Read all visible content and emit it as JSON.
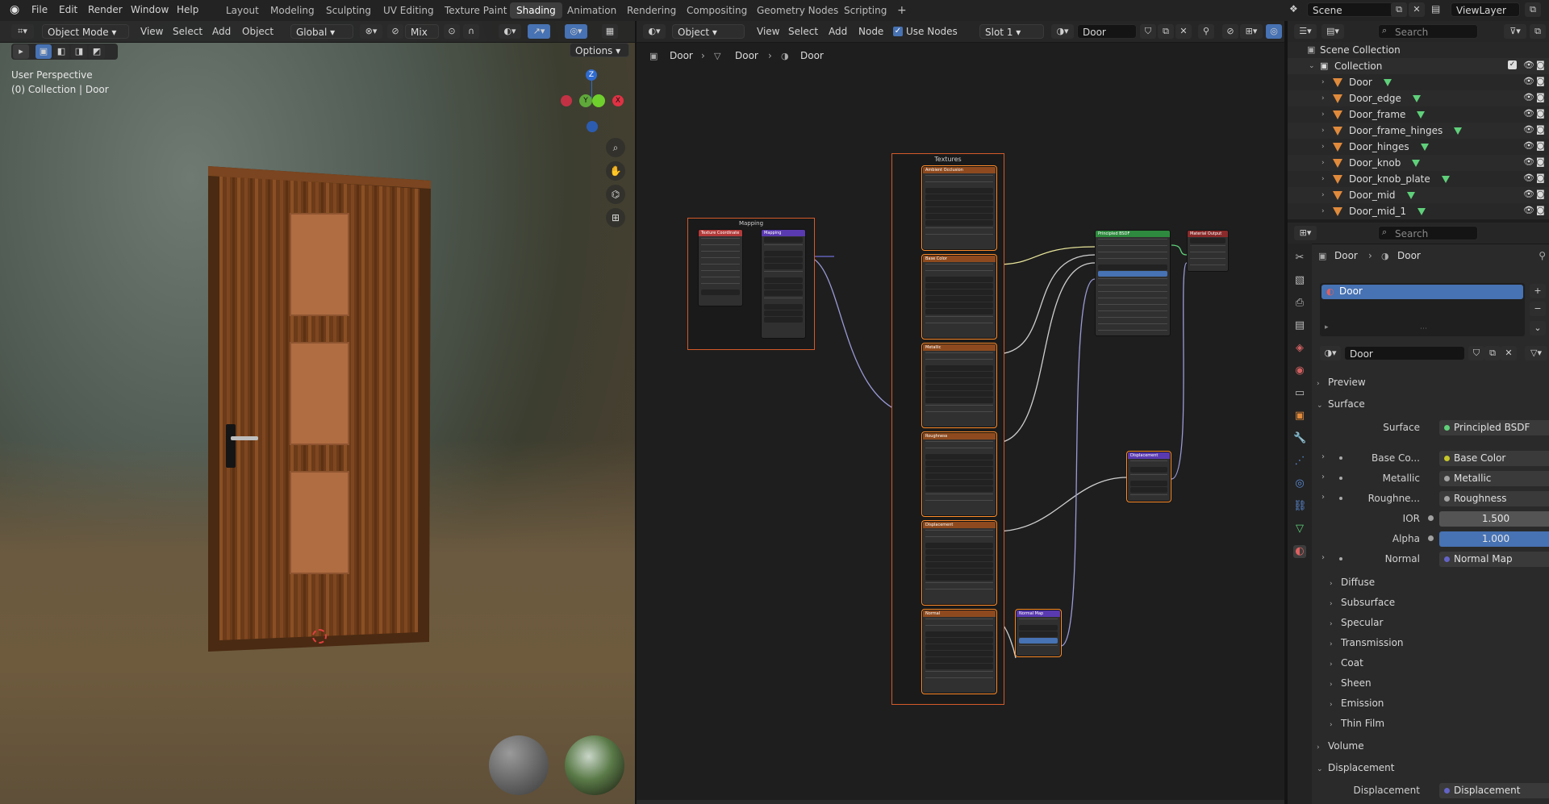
{
  "topbar": {
    "menus": [
      "File",
      "Edit",
      "Render",
      "Window",
      "Help"
    ],
    "workspaces": [
      "Layout",
      "Modeling",
      "Sculpting",
      "UV Editing",
      "Texture Paint",
      "Shading",
      "Animation",
      "Rendering",
      "Compositing",
      "Geometry Nodes",
      "Scripting"
    ],
    "active_workspace": "Shading",
    "add_tab": "+",
    "scene_label": "Scene",
    "viewlayer_label": "ViewLayer"
  },
  "viewport": {
    "mode": "Object Mode",
    "menus": [
      "View",
      "Select",
      "Add",
      "Object"
    ],
    "transform": "Global",
    "pivot": "Mix",
    "options": "Options",
    "perspective": "User Perspective",
    "collection_info": "(0) Collection | Door",
    "gizmo": {
      "z": "Z",
      "y": "Y",
      "x": "X"
    }
  },
  "node_editor": {
    "type": "Object",
    "menus": [
      "View",
      "Select",
      "Add",
      "Node"
    ],
    "use_nodes_label": "Use Nodes",
    "slot": "Slot 1",
    "material": "Door",
    "breadcrumb": [
      "Door",
      "Door",
      "Door"
    ],
    "frames": {
      "mapping": "Mapping",
      "textures": "Textures"
    },
    "nodes": {
      "tex_coord": "Texture Coordinate",
      "mapping": "Mapping",
      "ao": "Ambient Occlusion",
      "base_color": "Base Color",
      "metallic": "Metallic",
      "roughness": "Roughness",
      "displacement": "Displacement",
      "normal": "Normal",
      "bsdf": "Principled BSDF",
      "output": "Material Output",
      "disp_node": "Displacement",
      "normal_map": "Normal Map"
    }
  },
  "outliner": {
    "search_placeholder": "Search",
    "root": "Scene Collection",
    "collection": "Collection",
    "items": [
      "Door",
      "Door_edge",
      "Door_frame",
      "Door_frame_hinges",
      "Door_hinges",
      "Door_knob",
      "Door_knob_plate",
      "Door_mid",
      "Door_mid_1"
    ]
  },
  "properties": {
    "search_placeholder": "Search",
    "breadcrumb": [
      "Door",
      "Door"
    ],
    "slot_item": "Door",
    "material_name": "Door",
    "sections": {
      "preview": "Preview",
      "surface": "Surface",
      "volume": "Volume",
      "displacement": "Displacement"
    },
    "surface_row": {
      "label": "Surface",
      "value": "Principled BSDF"
    },
    "inputs": [
      {
        "label": "Base Co...",
        "value": "Base Color",
        "type": "link",
        "color": "#c7c729"
      },
      {
        "label": "Metallic",
        "value": "Metallic",
        "type": "link",
        "color": "#a1a1a1"
      },
      {
        "label": "Roughne...",
        "value": "Roughness",
        "type": "link",
        "color": "#a1a1a1"
      },
      {
        "label": "IOR",
        "value": "1.500",
        "type": "num",
        "color": "#a1a1a1"
      },
      {
        "label": "Alpha",
        "value": "1.000",
        "type": "num-blue",
        "color": "#a1a1a1"
      },
      {
        "label": "Normal",
        "value": "Normal Map",
        "type": "link",
        "color": "#6363c7"
      }
    ],
    "subpanels": [
      "Diffuse",
      "Subsurface",
      "Specular",
      "Transmission",
      "Coat",
      "Sheen",
      "Emission",
      "Thin Film"
    ],
    "displacement_row": {
      "label": "Displacement",
      "value": "Displacement"
    }
  }
}
